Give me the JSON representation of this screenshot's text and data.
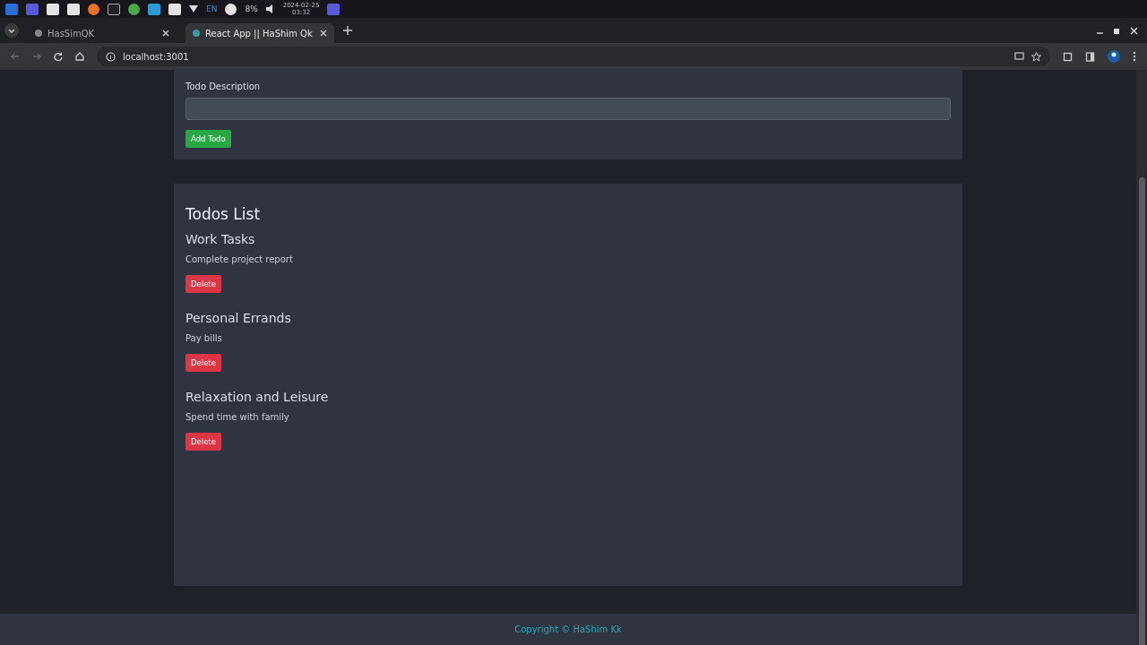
{
  "taskbar": {
    "battery": "8%",
    "language": "EN",
    "date": "2024-02-25",
    "time": "03:32"
  },
  "tabs": [
    {
      "title": "HasSimQK",
      "selected": false
    },
    {
      "title": "React App || HaShim Qk",
      "selected": true
    }
  ],
  "address_bar": {
    "url": "localhost:3001"
  },
  "form": {
    "label": "Todo Description",
    "button": "Add Todo"
  },
  "todos_list": {
    "heading": "Todos List",
    "items": [
      {
        "title": "Work Tasks",
        "description": "Complete project report",
        "button": "Delete"
      },
      {
        "title": "Personal Errands",
        "description": "Pay bills",
        "button": "Delete"
      },
      {
        "title": "Relaxation and Leisure",
        "description": "Spend time with family",
        "button": "Delete"
      }
    ]
  },
  "footer": {
    "text": "Copyright © HaShim Kk"
  }
}
